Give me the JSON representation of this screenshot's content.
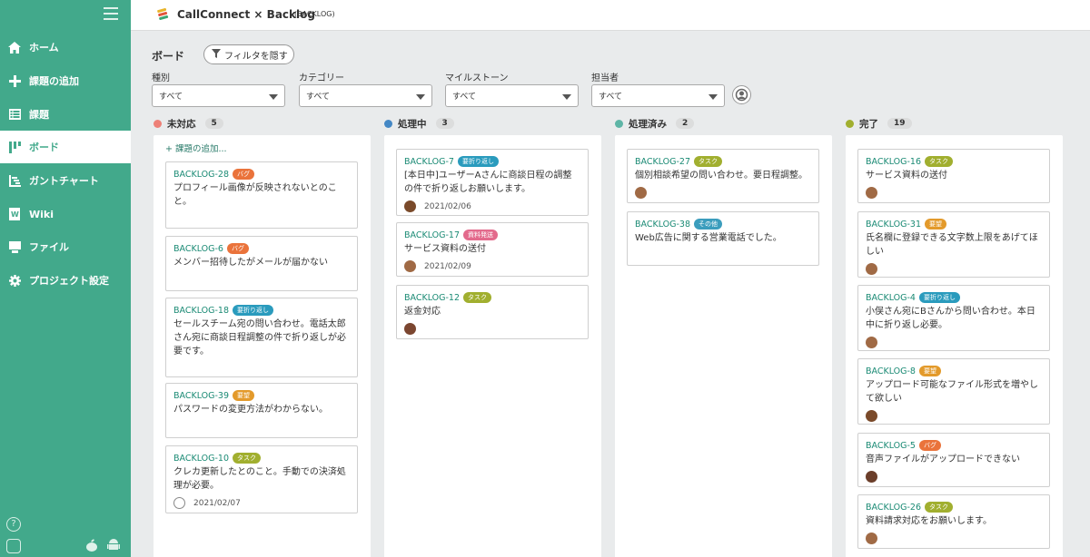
{
  "sidebar": {
    "items": [
      {
        "label": "ホーム",
        "icon": "home-icon"
      },
      {
        "label": "課題の追加",
        "icon": "plus-icon"
      },
      {
        "label": "課題",
        "icon": "list-icon"
      },
      {
        "label": "ボード",
        "icon": "board-icon"
      },
      {
        "label": "ガントチャート",
        "icon": "gantt-icon"
      },
      {
        "label": "Wiki",
        "icon": "wiki-icon"
      },
      {
        "label": "ファイル",
        "icon": "file-icon"
      },
      {
        "label": "プロジェクト設定",
        "icon": "gear-icon"
      }
    ],
    "active_index": 3,
    "help_label": "?"
  },
  "header": {
    "title": "CallConnect × Backlog",
    "project_key": "(BACKLOG)"
  },
  "board": {
    "title": "ボード",
    "filter_button": "フィルタを隠す"
  },
  "filters": [
    {
      "label": "種別",
      "value": "すべて"
    },
    {
      "label": "カテゴリー",
      "value": "すべて"
    },
    {
      "label": "マイルストーン",
      "value": "すべて"
    },
    {
      "label": "担当者",
      "value": "すべて"
    }
  ],
  "add_issue_label": "+ 課題の追加...",
  "columns": [
    {
      "name": "未対応",
      "count": "5",
      "color": "#ed8077"
    },
    {
      "name": "処理中",
      "count": "3",
      "color": "#4488c5"
    },
    {
      "name": "処理済み",
      "count": "2",
      "color": "#5eb5a6"
    },
    {
      "name": "完了",
      "count": "19",
      "color": "#a1af2f"
    }
  ],
  "cards": {
    "c0": [
      {
        "key": "BACKLOG-28",
        "tag": "バグ",
        "summary": "プロフィール画像が反映されないとのこと。",
        "date": ""
      },
      {
        "key": "BACKLOG-6",
        "tag": "バグ",
        "summary": "メンバー招待したがメールが届かない",
        "date": ""
      },
      {
        "key": "BACKLOG-18",
        "tag": "要折り返し",
        "summary": "セールスチーム宛の問い合わせ。電話太郎さん宛に商談日程調整の件で折り返しが必要です。",
        "date": ""
      },
      {
        "key": "BACKLOG-39",
        "tag": "要望",
        "summary": "パスワードの変更方法がわからない。",
        "date": ""
      },
      {
        "key": "BACKLOG-10",
        "tag": "タスク",
        "summary": "クレカ更新したとのこと。手動での決済処理が必要。",
        "date": "2021/02/07"
      }
    ],
    "c1": [
      {
        "key": "BACKLOG-7",
        "tag": "要折り返し",
        "summary": "[本日中]ユーザーAさんに商談日程の調整の件で折り返しお願いします。",
        "date": "2021/02/06"
      },
      {
        "key": "BACKLOG-17",
        "tag": "資料発送",
        "summary": "サービス資料の送付",
        "date": "2021/02/09"
      },
      {
        "key": "BACKLOG-12",
        "tag": "タスク",
        "summary": "返金対応",
        "date": ""
      }
    ],
    "c2": [
      {
        "key": "BACKLOG-27",
        "tag": "タスク",
        "summary": "個別相談希望の問い合わせ。要日程調整。",
        "date": ""
      },
      {
        "key": "BACKLOG-38",
        "tag": "その他",
        "summary": "Web広告に関する営業電話でした。",
        "date": ""
      }
    ],
    "c3": [
      {
        "key": "BACKLOG-16",
        "tag": "タスク",
        "summary": "サービス資料の送付",
        "date": ""
      },
      {
        "key": "BACKLOG-31",
        "tag": "要望",
        "summary": "氏名欄に登録できる文字数上限をあげてほしい",
        "date": ""
      },
      {
        "key": "BACKLOG-4",
        "tag": "要折り返し",
        "summary": "小俣さん宛にBさんから問い合わせ。本日中に折り返し必要。",
        "date": ""
      },
      {
        "key": "BACKLOG-8",
        "tag": "要望",
        "summary": "アップロード可能なファイル形式を増やして欲しい",
        "date": ""
      },
      {
        "key": "BACKLOG-5",
        "tag": "バグ",
        "summary": "音声ファイルがアップロードできない",
        "date": ""
      },
      {
        "key": "BACKLOG-26",
        "tag": "タスク",
        "summary": "資料請求対応をお願いします。",
        "date": ""
      }
    ]
  },
  "tag_colors": {
    "バグ": "#ea733b",
    "要折り返し": "#2a9bbd",
    "要望": "#e39a2b",
    "タスク": "#a1af2f",
    "資料発送": "#e36a8c",
    "その他": "#3b9dbd"
  }
}
